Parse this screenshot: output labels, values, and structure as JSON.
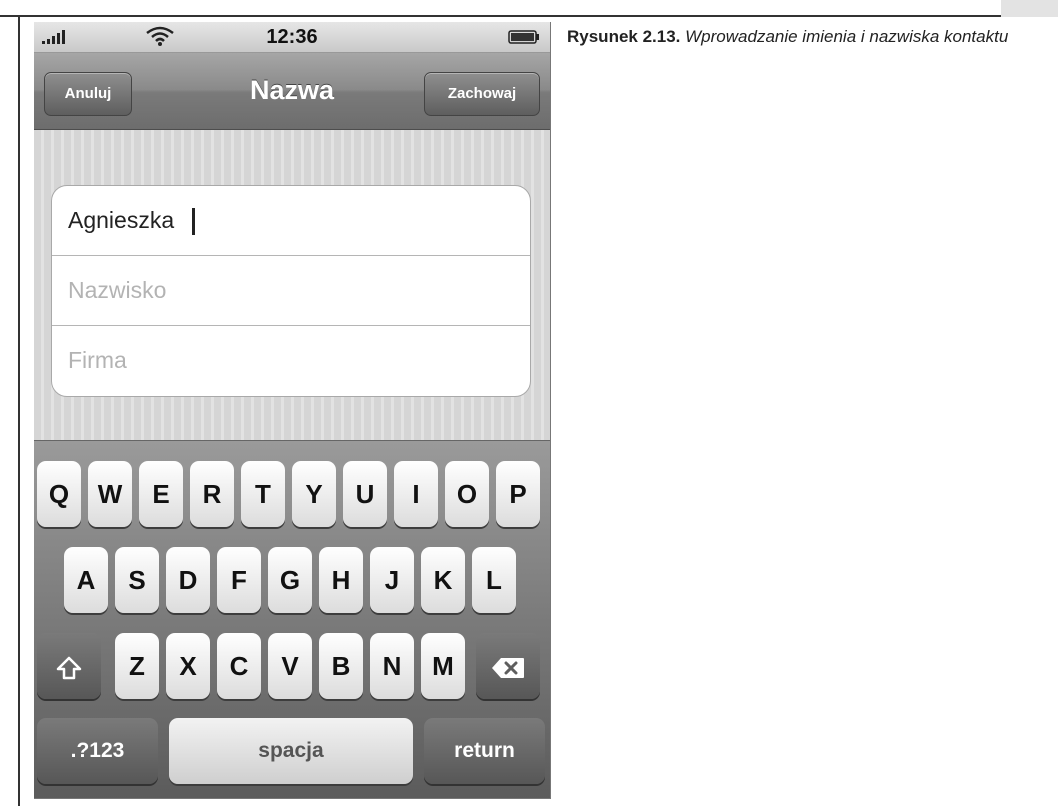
{
  "status_bar": {
    "time": "12:36",
    "icons": [
      "signal-icon",
      "wifi-icon",
      "battery-icon"
    ]
  },
  "nav_bar": {
    "cancel_label": "Anuluj",
    "title": "Nazwa",
    "save_label": "Zachowaj"
  },
  "form": {
    "first_name_value": "Agnieszka",
    "last_name_placeholder": "Nazwisko",
    "company_placeholder": "Firma"
  },
  "keyboard": {
    "row1": [
      "Q",
      "W",
      "E",
      "R",
      "T",
      "Y",
      "U",
      "I",
      "O",
      "P"
    ],
    "row2": [
      "A",
      "S",
      "D",
      "F",
      "G",
      "H",
      "J",
      "K",
      "L"
    ],
    "row3": [
      "Z",
      "X",
      "C",
      "V",
      "B",
      "N",
      "M"
    ],
    "numbers_label": ".?123",
    "space_label": "spacja",
    "return_label": "return",
    "shift_icon": "shift-arrow-icon",
    "delete_icon": "backspace-icon"
  },
  "caption": {
    "label": "Rysunek 2.13.",
    "text": "Wprowadzanie imienia i nazwiska kontaktu"
  },
  "colors": {
    "nav_bar": "#7d7d7d",
    "keyboard_bg": "#707070",
    "key_face": "#f0f0f0"
  }
}
